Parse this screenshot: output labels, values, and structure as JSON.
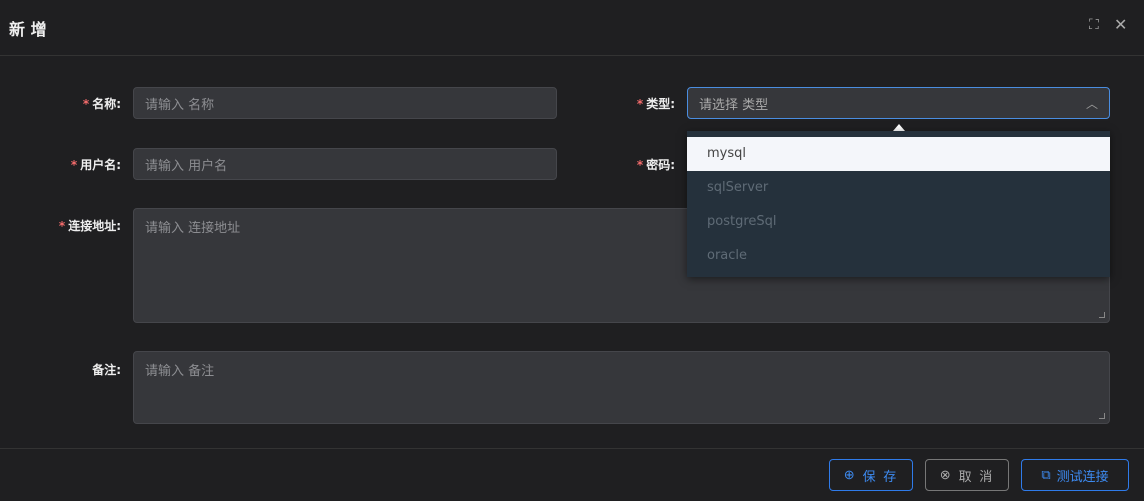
{
  "dialog": {
    "title": "新 增"
  },
  "form": {
    "name": {
      "label": "名称:",
      "placeholder": "请输入 名称"
    },
    "type": {
      "label": "类型:",
      "placeholder": "请选择 类型",
      "options": [
        "mysql",
        "sqlServer",
        "postgreSql",
        "oracle"
      ],
      "highlighted": "mysql"
    },
    "username": {
      "label": "用户名:",
      "placeholder": "请输入 用户名"
    },
    "password": {
      "label": "密码:"
    },
    "url": {
      "label": "连接地址:",
      "placeholder": "请输入 连接地址"
    },
    "remark": {
      "label": "备注:",
      "placeholder": "请输入 备注"
    },
    "required_mark": "*"
  },
  "footer": {
    "save": "保 存",
    "cancel": "取 消",
    "test": "测试连接"
  },
  "colors": {
    "accent": "#2f7bea",
    "required": "#f56c6c"
  }
}
